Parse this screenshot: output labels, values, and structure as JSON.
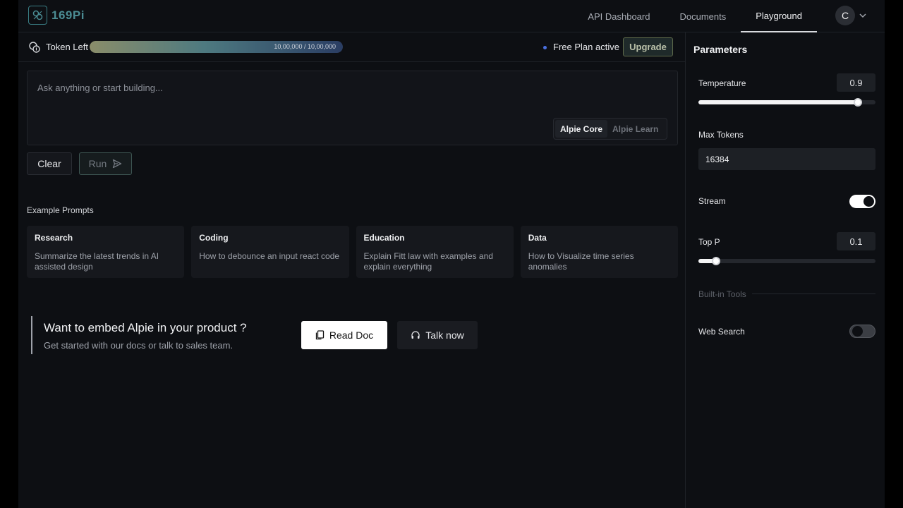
{
  "brand": {
    "name": "169Pi"
  },
  "nav": {
    "items": [
      {
        "label": "API Dashboard",
        "active": false
      },
      {
        "label": "Documents",
        "active": false
      },
      {
        "label": "Playground",
        "active": true
      }
    ],
    "avatar_initial": "C"
  },
  "tokens": {
    "label": "Token Left",
    "count_text": "10,00,000 / 10,00,000",
    "fill_percent": 100
  },
  "plan": {
    "status": "Free Plan active",
    "upgrade_label": "Upgrade",
    "dot_color": "#4a70e0"
  },
  "prompt": {
    "placeholder": "Ask anything or start building...",
    "models": [
      {
        "label": "Alpie Core",
        "active": true
      },
      {
        "label": "Alpie Learn",
        "active": false
      }
    ]
  },
  "actions": {
    "clear_label": "Clear",
    "run_label": "Run"
  },
  "examples": {
    "title": "Example Prompts",
    "cards": [
      {
        "title": "Research",
        "desc": "Summarize the latest trends in AI assisted design"
      },
      {
        "title": "Coding",
        "desc": "How to debounce an input react code"
      },
      {
        "title": "Education",
        "desc": "Explain Fitt law with examples and explain everything"
      },
      {
        "title": "Data",
        "desc": "How to Visualize time series anomalies"
      }
    ]
  },
  "promo": {
    "title": "Want to embed Alpie in your product ?",
    "subtitle": "Get started with our docs or talk to sales team.",
    "read_doc_label": "Read Doc",
    "talk_label": "Talk now"
  },
  "parameters": {
    "title": "Parameters",
    "temperature": {
      "label": "Temperature",
      "value": "0.9",
      "fraction": 0.9
    },
    "max_tokens": {
      "label": "Max Tokens",
      "value": "16384"
    },
    "stream": {
      "label": "Stream",
      "on": true
    },
    "top_p": {
      "label": "Top P",
      "value": "0.1",
      "fraction": 0.1
    },
    "builtin_tools_label": "Built-in Tools",
    "web_search": {
      "label": "Web Search",
      "on": false
    }
  }
}
